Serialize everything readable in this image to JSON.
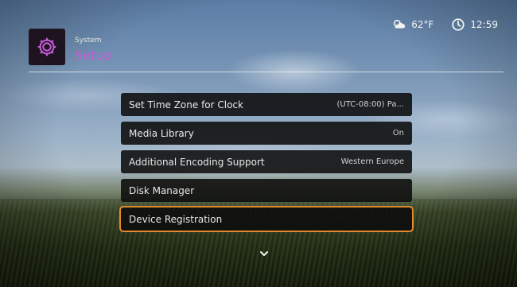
{
  "header": {
    "section": "System",
    "title": "Setup",
    "icon": "gear-icon",
    "accent": "#c65bd8"
  },
  "status": {
    "weather_icon": "cloud-sun-icon",
    "temperature": "62°F",
    "clock_icon": "clock-icon",
    "time": "12:59"
  },
  "menu": {
    "items": [
      {
        "label": "Set Time Zone for Clock",
        "value": "(UTC-08:00) Pa..."
      },
      {
        "label": "Media Library",
        "value": "On"
      },
      {
        "label": "Additional Encoding Support",
        "value": "Western Europe"
      },
      {
        "label": "Disk Manager",
        "value": ""
      },
      {
        "label": "Device Registration",
        "value": ""
      }
    ],
    "selected_index": 4,
    "selection_color": "#e38a2e"
  },
  "scroll_indicator": "chevron-down-icon"
}
